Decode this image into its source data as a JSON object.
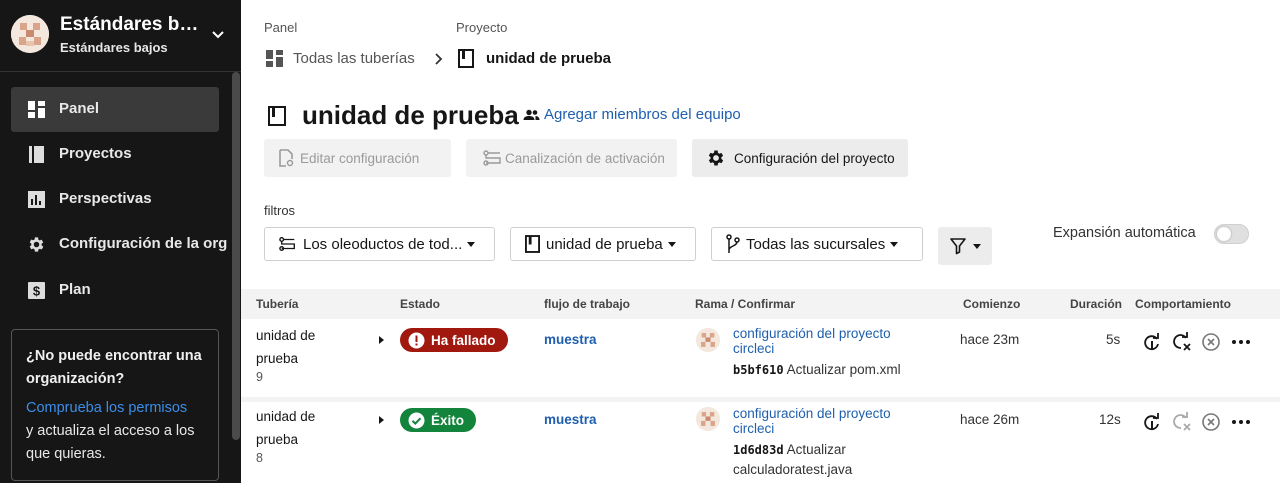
{
  "org": {
    "name": "Estándares ba...",
    "subtitle": "Estándares bajos"
  },
  "sidebar": {
    "items": [
      {
        "label": "Panel",
        "icon": "dashboard-icon",
        "active": true
      },
      {
        "label": "Proyectos",
        "icon": "project-icon",
        "active": false
      },
      {
        "label": "Perspectivas",
        "icon": "insights-icon",
        "active": false
      },
      {
        "label": "Configuración de la org",
        "icon": "gear-icon",
        "active": false
      },
      {
        "label": "Plan",
        "icon": "dollar-icon",
        "active": false
      }
    ],
    "help": {
      "title": "¿No puede encontrar una organización?",
      "link": "Comprueba los permisos",
      "text": "y actualiza el acceso a los que quieras."
    }
  },
  "breadcrumb": {
    "panel_label": "Panel",
    "project_label": "Proyecto",
    "all_pipelines": "Todas las tuberías",
    "project": "unidad de prueba"
  },
  "header": {
    "title": "unidad de prueba",
    "add_members": "Agregar miembros del equipo"
  },
  "toolbar": {
    "edit_config": "Editar configuración",
    "trigger_pipeline": "Canalización de activación",
    "project_settings": "Configuración del proyecto"
  },
  "filters": {
    "label": "filtros",
    "pipelines": "Los oleoductos de tod...",
    "project": "unidad de prueba",
    "branches": "Todas las sucursales",
    "auto_expand": "Expansión automática",
    "auto_expand_on": false
  },
  "table": {
    "headers": [
      "Tubería",
      "Estado",
      "flujo de trabajo",
      "Rama / Confirmar",
      "Comienzo",
      "Duración",
      "Comportamiento"
    ],
    "rows": [
      {
        "pipeline_line1": "unidad de",
        "pipeline_line2": "prueba",
        "number": "9",
        "status": "Ha fallado",
        "workflow": "muestra",
        "branch": "configuración del proyecto circleci",
        "sha": "b5bf610",
        "message": "Actualizar pom.xml",
        "start": "hace 23m",
        "duration": "5s"
      },
      {
        "pipeline_line1": "unidad de",
        "pipeline_line2": "prueba",
        "number": "8",
        "status": "Éxito",
        "workflow": "muestra",
        "branch": "configuración del proyecto circleci",
        "sha": "1d6d83d",
        "message": "Actualizar calculadoratest.java",
        "start": "hace 26m",
        "duration": "12s"
      }
    ]
  },
  "colors": {
    "sidebar_bg": "#161616",
    "link": "#1f5fae",
    "failed": "#a1180f",
    "success": "#12843b"
  }
}
